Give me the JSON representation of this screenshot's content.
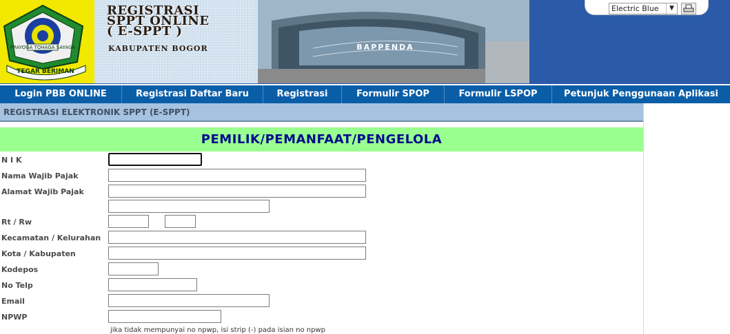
{
  "header": {
    "title_lines": [
      "REGISTRASI",
      "SPPT ONLINE",
      "( E-SPPT )"
    ],
    "region": "KABUPATEN BOGOR",
    "logo_motto": "TEGAR BERIMAN",
    "logo_text": "PRAYOGA TOHAGA SAYAGA",
    "building_sign": "BAPPENDA",
    "theme_select": {
      "value": "Electric Blue"
    }
  },
  "nav": {
    "items": [
      {
        "label": "Login PBB ONLINE"
      },
      {
        "label": "Registrasi Daftar Baru"
      },
      {
        "label": "Registrasi"
      },
      {
        "label": "Formulir SPOP"
      },
      {
        "label": "Formulir LSPOP"
      },
      {
        "label": "Petunjuk Penggunaan Aplikasi"
      }
    ]
  },
  "section": {
    "title": "REGISTRASI ELEKTRONIK SPPT (E-SPPT)"
  },
  "form": {
    "heading": "PEMILIK/PEMANFAAT/PENGELOLA",
    "labels": {
      "nik": "N I K",
      "nama": "Nama Wajib Pajak",
      "alamat": "Alamat Wajib Pajak",
      "rtrw": "Rt / Rw",
      "kecamatan": "Kecamatan / Kelurahan",
      "kota": "Kota / Kabupaten",
      "kodepos": "Kodepos",
      "telp": "No Telp",
      "email": "Email",
      "npwp": "NPWP"
    },
    "values": {
      "nik": "",
      "nama": "",
      "alamat1": "",
      "alamat2": "",
      "rt": "",
      "rw": "",
      "kecamatan": "",
      "kota": "",
      "kodepos": "",
      "telp": "",
      "email": "",
      "npwp": ""
    },
    "npwp_note": "jika tidak mempunyai no npwp, isi strip (-) pada isian no npwp"
  },
  "colors": {
    "nav_bg": "#0a5ea8",
    "header_bg": "#2a5aa8",
    "section_bar": "#a6c2e1",
    "heading_bg": "#99ff8f",
    "heading_text": "#000a8c"
  }
}
